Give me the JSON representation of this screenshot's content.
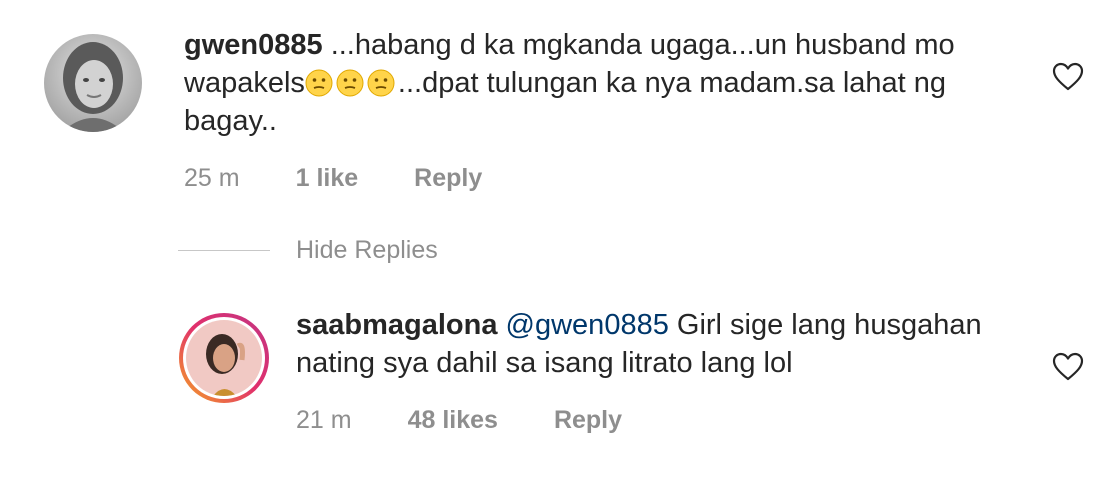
{
  "comments": [
    {
      "username": "gwen0885",
      "text_part1": " ...habang d ka mgkanda ugaga...un husband mo wapakels",
      "emoji_icon": "confused-face-emoji",
      "emoji_count": 3,
      "text_part2": "...dpat tulungan ka nya madam.sa lahat ng bagay..",
      "time": "25 m",
      "likes": "1 like",
      "reply_label": "Reply"
    },
    {
      "username": "saabmagalona",
      "mention": "@gwen0885",
      "text": " Girl sige lang husgahan nating sya dahil sa isang litrato lang lol",
      "time": "21 m",
      "likes": "48 likes",
      "reply_label": "Reply"
    }
  ],
  "thread": {
    "hide_replies_label": "Hide Replies"
  },
  "colors": {
    "text": "#262626",
    "muted": "#8e8e8e",
    "mention": "#00376b",
    "story_ring": [
      "#f5a623",
      "#e1306c",
      "#c13584"
    ]
  }
}
